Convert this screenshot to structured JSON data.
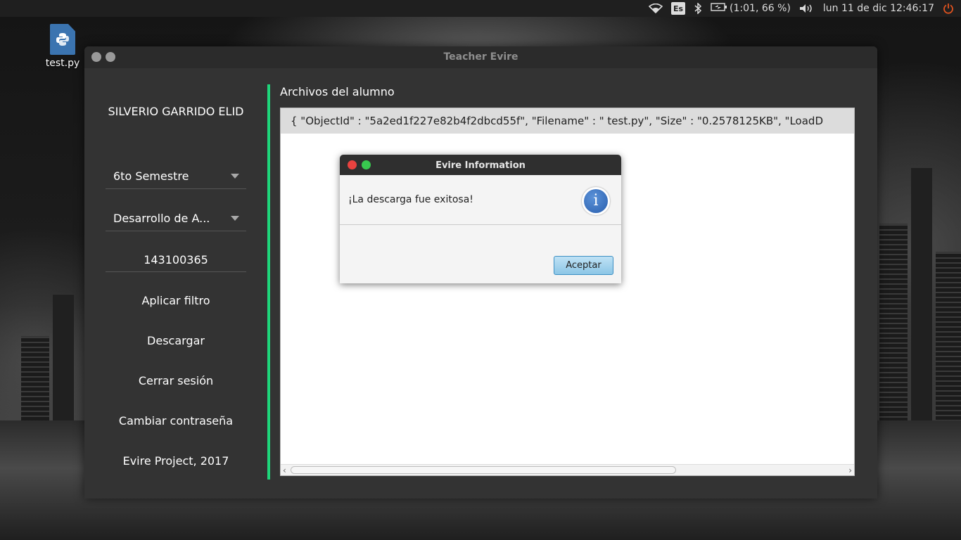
{
  "top_panel": {
    "keyboard_layout": "Es",
    "battery": "(1:01, 66 %)",
    "datetime": "lun 11 de dic 12:46:17",
    "icons": [
      "wifi-icon",
      "bluetooth-icon",
      "battery-icon",
      "volume-icon",
      "power-icon"
    ]
  },
  "desktop": {
    "file_label": "test.py",
    "file_icon": "python-file-icon"
  },
  "window": {
    "title": "Teacher Evire",
    "sidebar": {
      "user_name": "SILVERIO GARRIDO ELID",
      "semester_select": "6to Semestre",
      "subject_select": "Desarrollo de A...",
      "student_id": "143100365",
      "apply_filter": "Aplicar filtro",
      "download": "Descargar",
      "logout": "Cerrar sesión",
      "change_password": "Cambiar contraseña",
      "footer": "Evire Project, 2017"
    },
    "content": {
      "title": "Archivos del alumno",
      "rows": [
        "{ \"ObjectId\" : \"5a2ed1f227e82b4f2dbcd55f\", \"Filename\" : \" test.py\", \"Size\" : \"0.2578125KB\", \"LoadD"
      ]
    }
  },
  "dialog": {
    "title": "Evire Information",
    "message": "¡La descarga fue exitosa!",
    "ok_button": "Aceptar"
  },
  "colors": {
    "accent": "#1ed67a",
    "window_bg": "#333333",
    "dialog_button": "#8cc6e6",
    "power": "#e2531f"
  }
}
